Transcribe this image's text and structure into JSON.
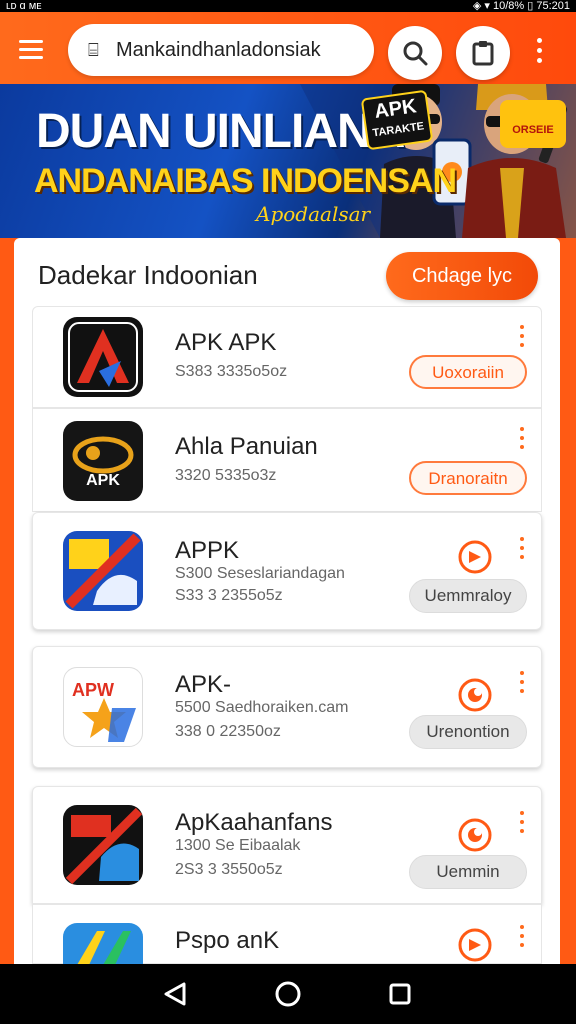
{
  "status_bar": {
    "left": "ʟᴅ ɑ ᴍᴇ",
    "right": "◈ ▾ 10/8% ▯ 75:201"
  },
  "search": {
    "value": "Mankaindhanladonsiak"
  },
  "icons": {
    "menu": "hamburger-icon",
    "search": "search-icon",
    "clipboard": "clipboard-icon",
    "overflow": "more-vertical-icon",
    "back": "back-triangle-icon",
    "home": "home-circle-icon",
    "recents": "recents-square-icon"
  },
  "banner": {
    "title_main": "DUAN UINLIANA",
    "title_sub": "ANDANAIBAS INDOENSAN",
    "script": "Apodaalsar",
    "badge_line1": "APK",
    "badge_line2": "TARAKTE",
    "promo": "ORSEIE"
  },
  "section": {
    "title": "Dadekar Indoonian",
    "change_button": "Chdage lyc"
  },
  "apps": [
    {
      "name": "APK APK",
      "line1": "",
      "line2": "S383 3335o5oz",
      "button": "Uoxoraiin"
    },
    {
      "name": "Ahla Panuian",
      "line1": "",
      "line2": "3320 5335o3z",
      "button": "Dranoraitn"
    },
    {
      "name": "APPK",
      "line1": "S300 Seseslariandagan",
      "line2": "S33 3 2355o5z",
      "button": "Uemmraloy"
    },
    {
      "name": "APK-",
      "line1": "5500 Saedhoraiken.cam",
      "line2": "338 0 22350oz",
      "button": "Urenontion"
    },
    {
      "name": "ApKaahanfans",
      "line1": "1300 Se Eibaalak",
      "line2": "2S3 3 3550o5z",
      "button": "Uemmin"
    },
    {
      "name": "Pspo anK",
      "line1": "",
      "line2": "",
      "button": ""
    }
  ],
  "colors": {
    "accent": "#ff5a14",
    "banner_blue": "#1452c4",
    "banner_yellow": "#ffd21a"
  }
}
